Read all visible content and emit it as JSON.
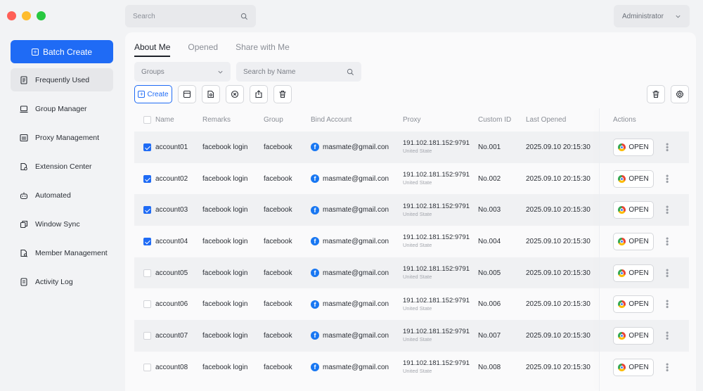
{
  "window": {
    "traffic_colors": [
      "#ff5f57",
      "#febc2e",
      "#28c840"
    ]
  },
  "top": {
    "search_placeholder": "Search",
    "user": "Administrator"
  },
  "sidebar": {
    "batch_create": "Batch Create",
    "items": [
      {
        "label": "Frequently Used",
        "icon": "frequently-used-icon"
      },
      {
        "label": "Group Manager",
        "icon": "group-manager-icon"
      },
      {
        "label": "Proxy Management",
        "icon": "proxy-management-icon"
      },
      {
        "label": "Extension Center",
        "icon": "extension-center-icon"
      },
      {
        "label": "Automated",
        "icon": "automated-icon"
      },
      {
        "label": "Window Sync",
        "icon": "window-sync-icon"
      },
      {
        "label": "Member Management",
        "icon": "member-management-icon"
      },
      {
        "label": "Activity Log",
        "icon": "activity-log-icon"
      }
    ]
  },
  "tabs": [
    "About Me",
    "Opened",
    "Share with Me"
  ],
  "filters": {
    "groups": "Groups",
    "search_name": "Search by Name"
  },
  "toolbar": {
    "create": "Create"
  },
  "table": {
    "headers": [
      "Name",
      "Remarks",
      "Group",
      "Bind Account",
      "Proxy",
      "Custom ID",
      "Last Opened",
      "Actions"
    ],
    "open_label": "OPEN",
    "rows": [
      {
        "checked": true,
        "name": "account01",
        "remarks": "facebook login",
        "group": "facebook",
        "bind": "masmate@gmail.con",
        "proxy": "191.102.181.152:9791",
        "location": "United State",
        "cid": "No.001",
        "last": "2025.09.10 20:15:30"
      },
      {
        "checked": true,
        "name": "account02",
        "remarks": "facebook login",
        "group": "facebook",
        "bind": "masmate@gmail.con",
        "proxy": "191.102.181.152:9791",
        "location": "United State",
        "cid": "No.002",
        "last": "2025.09.10 20:15:30"
      },
      {
        "checked": true,
        "name": "account03",
        "remarks": "facebook login",
        "group": "facebook",
        "bind": "masmate@gmail.con",
        "proxy": "191.102.181.152:9791",
        "location": "United State",
        "cid": "No.003",
        "last": "2025.09.10 20:15:30"
      },
      {
        "checked": true,
        "name": "account04",
        "remarks": "facebook login",
        "group": "facebook",
        "bind": "masmate@gmail.con",
        "proxy": "191.102.181.152:9791",
        "location": "United State",
        "cid": "No.004",
        "last": "2025.09.10 20:15:30"
      },
      {
        "checked": false,
        "name": "account05",
        "remarks": "facebook login",
        "group": "facebook",
        "bind": "masmate@gmail.con",
        "proxy": "191.102.181.152:9791",
        "location": "United State",
        "cid": "No.005",
        "last": "2025.09.10 20:15:30"
      },
      {
        "checked": false,
        "name": "account06",
        "remarks": "facebook login",
        "group": "facebook",
        "bind": "masmate@gmail.con",
        "proxy": "191.102.181.152:9791",
        "location": "United State",
        "cid": "No.006",
        "last": "2025.09.10 20:15:30"
      },
      {
        "checked": false,
        "name": "account07",
        "remarks": "facebook login",
        "group": "facebook",
        "bind": "masmate@gmail.con",
        "proxy": "191.102.181.152:9791",
        "location": "United State",
        "cid": "No.007",
        "last": "2025.09.10 20:15:30"
      },
      {
        "checked": false,
        "name": "account08",
        "remarks": "facebook login",
        "group": "facebook",
        "bind": "masmate@gmail.con",
        "proxy": "191.102.181.152:9791",
        "location": "United State",
        "cid": "No.008",
        "last": "2025.09.10 20:15:30"
      }
    ]
  }
}
